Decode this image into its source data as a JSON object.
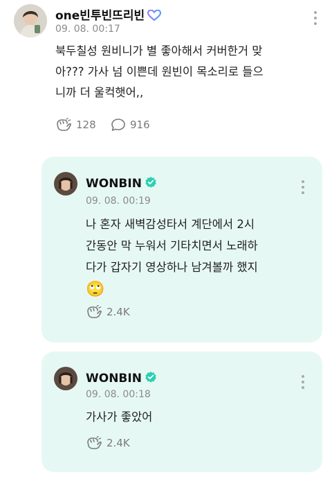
{
  "post": {
    "author": "one빈투빈뜨리빈",
    "timestamp": "09. 08. 00:17",
    "text_lines": [
      "북두칠성 원비니가 별 좋아해서 커버한거 맞",
      "아??? 가사 넘 이쁜데 원빈이 목소리로 들으",
      "니까 더 울컥햇어,,"
    ],
    "reaction_count": "128",
    "comment_count": "916",
    "badge_icon": "heart-badge-icon",
    "badge_color": "#6f8cf6"
  },
  "replies": [
    {
      "author": "WONBIN",
      "timestamp": "09. 08. 00:19",
      "text_lines": [
        "나 혼자 새벽감성타서 계단에서 2시",
        "간동안 막 누워서 기타치면서 노래하",
        "다가 갑자기 영상하나 남겨볼까 했지"
      ],
      "emoji": "🙄",
      "reaction_count": "2.4K"
    },
    {
      "author": "WONBIN",
      "timestamp": "09. 08. 00:18",
      "text_lines": [
        "가사가 좋았어"
      ],
      "reaction_count": "2.4K"
    }
  ],
  "colors": {
    "card_bg": "#e6f8f3",
    "verified": "#2bd0b2",
    "muted_text": "#8a8a8a"
  }
}
